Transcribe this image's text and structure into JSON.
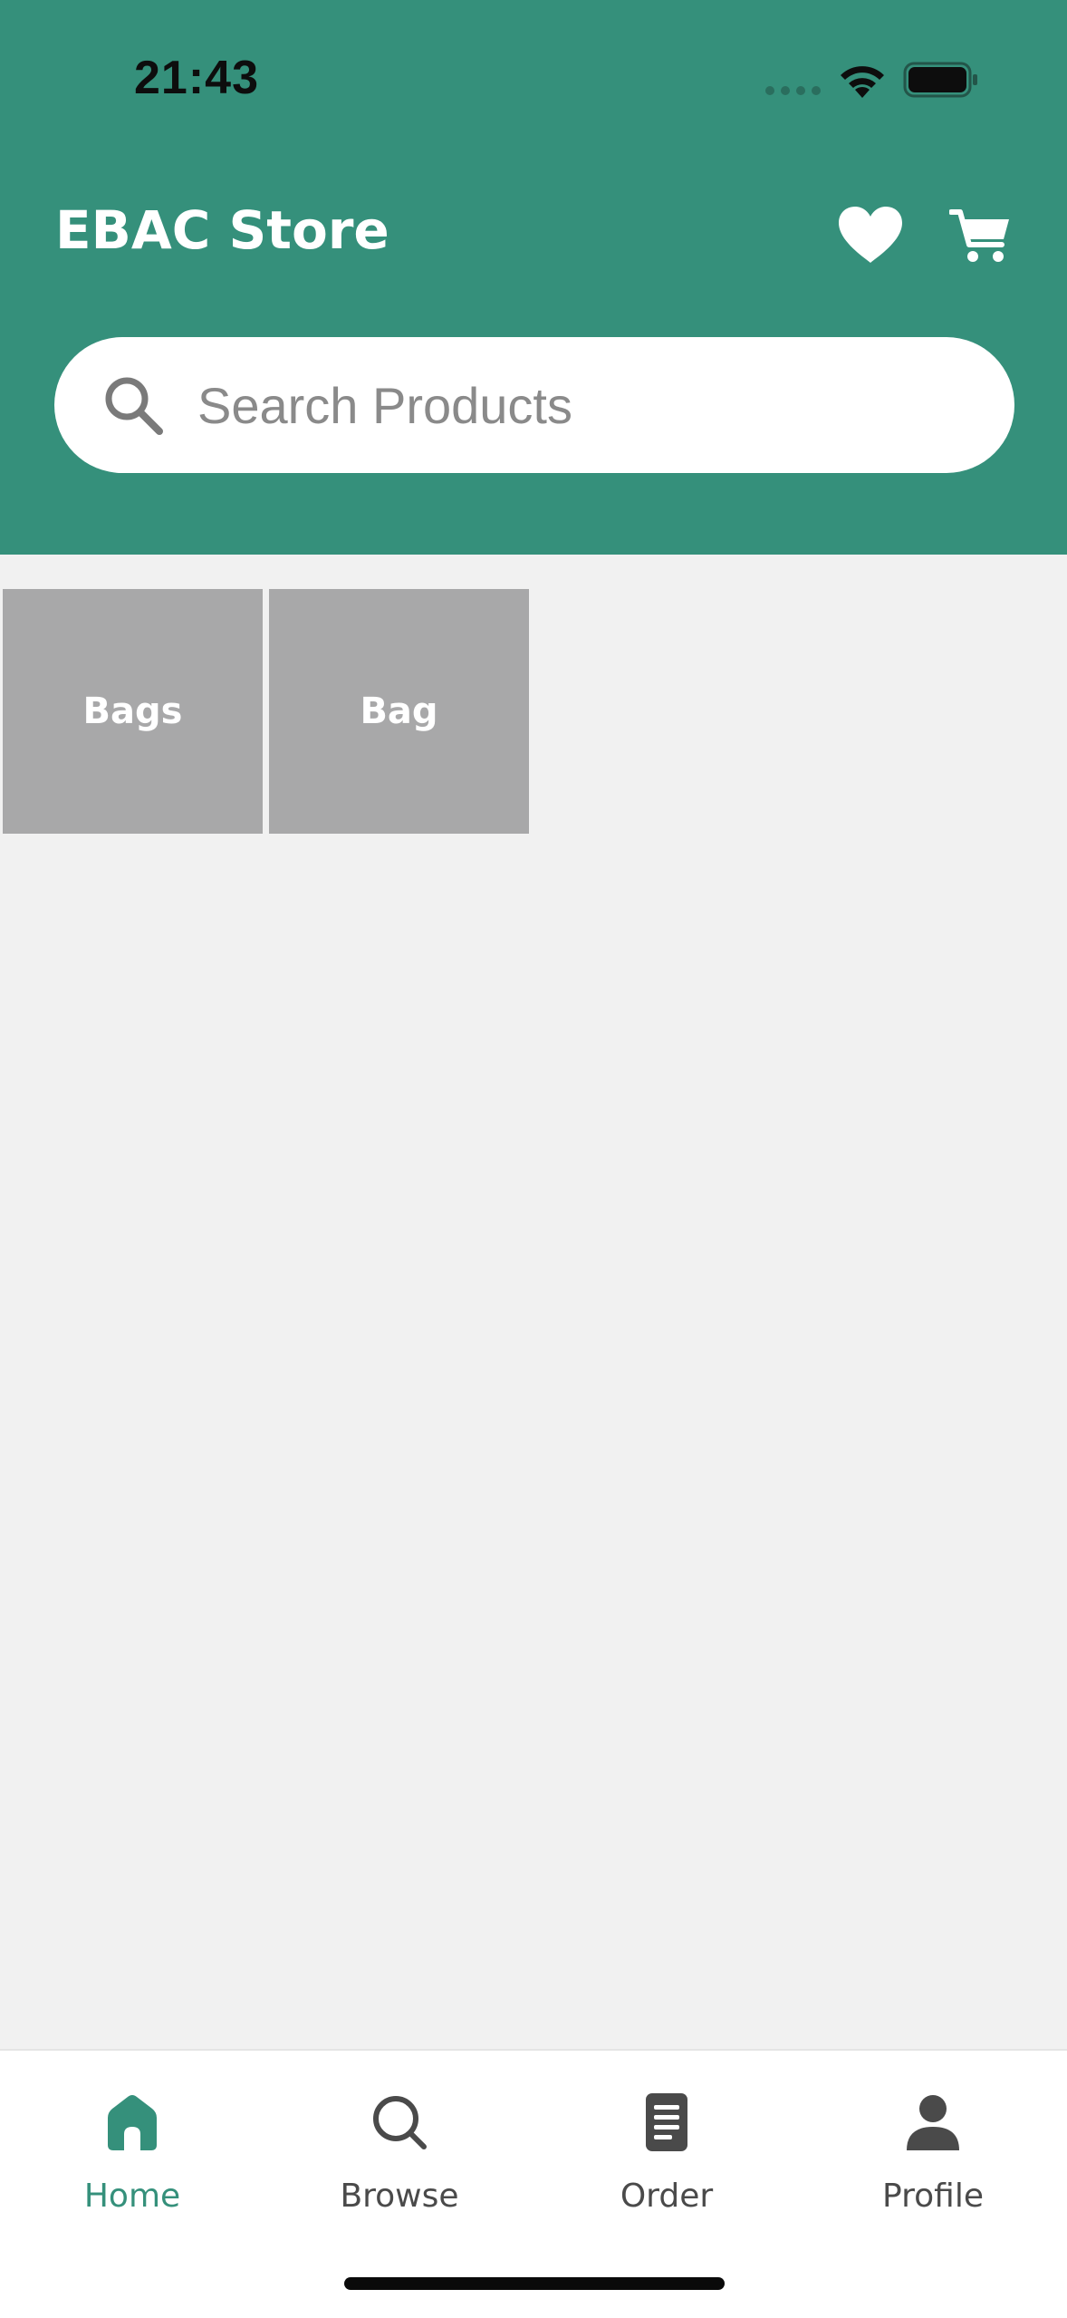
{
  "status_bar": {
    "time": "21:43",
    "icons": [
      "cellular-signal-icon",
      "wifi-icon",
      "battery-icon"
    ]
  },
  "header": {
    "title": "EBAC Store",
    "actions": [
      "heart-icon",
      "cart-icon"
    ],
    "background_color": "#35907b"
  },
  "search": {
    "placeholder": "Search Products",
    "value": ""
  },
  "categories": [
    {
      "label": "Bags"
    },
    {
      "label": "Bag"
    }
  ],
  "tabbar": {
    "active_color": "#35907b",
    "tabs": [
      {
        "label": "Home",
        "icon": "home-icon",
        "active": true
      },
      {
        "label": "Browse",
        "icon": "search-icon",
        "active": false
      },
      {
        "label": "Order",
        "icon": "receipt-icon",
        "active": false
      },
      {
        "label": "Profile",
        "icon": "person-icon",
        "active": false
      }
    ]
  }
}
